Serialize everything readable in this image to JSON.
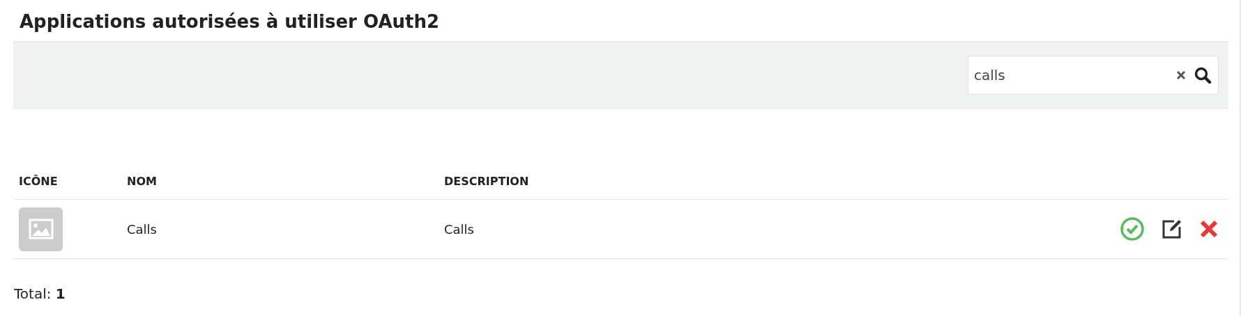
{
  "title": "Applications autorisées à utiliser OAuth2",
  "search": {
    "value": "calls"
  },
  "table": {
    "columns": [
      "ICÔNE",
      "NOM",
      "DESCRIPTION"
    ],
    "rows": [
      {
        "name": "Calls",
        "description": "Calls"
      }
    ]
  },
  "total": "Total: **1**"
}
